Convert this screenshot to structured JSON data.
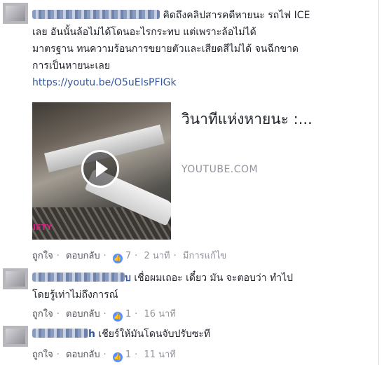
{
  "colors": {
    "link": "#365899",
    "meta": "#90949c",
    "like_badge": "#5890ff"
  },
  "comments": [
    {
      "author_blurred": true,
      "text_lines": [
        "คิดถึงคลิปสารคดีหายนะ รถไฟ ICE",
        "เลย อันนั้นล้อไม่ได้โดนอะไรกระทบ แต่เพราะล้อไม่ได้",
        "มาตรฐาน ทนความร้อนการขยายตัวและเสียดสีไม่ได้ จนฉีกขาด",
        "การเป็นหายนะเลย"
      ],
      "link": "https://youtu.be/O5uEIsPFIGk",
      "preview": {
        "title": "วินาทีแห่งหายนะ :...",
        "domain": "YOUTUBE.COM",
        "watermark": "IETY",
        "play_icon": "play-icon"
      },
      "actions": {
        "like": "ถูกใจ",
        "reply": "ตอบกลับ",
        "like_count": "7",
        "time": "2 นาที",
        "edited": "มีการแก้ไข"
      }
    },
    {
      "author_blurred": true,
      "author_suffix": "บ",
      "text_lines": [
        "เชื่อผมเถอะ เดี๋ยว มัน จะตอบว่า ทำไป",
        "โดยรู้เท่าไม่ถึงการณ์"
      ],
      "actions": {
        "like": "ถูกใจ",
        "reply": "ตอบกลับ",
        "like_count": "1",
        "time": "16 นาที"
      }
    },
    {
      "author_blurred": true,
      "author_suffix": "h",
      "text_lines": [
        "เชียร์ให้มันโดนจับปรับซะที"
      ],
      "actions": {
        "like": "ถูกใจ",
        "reply": "ตอบกลับ",
        "like_count": "1",
        "time": "11 นาที"
      }
    }
  ]
}
